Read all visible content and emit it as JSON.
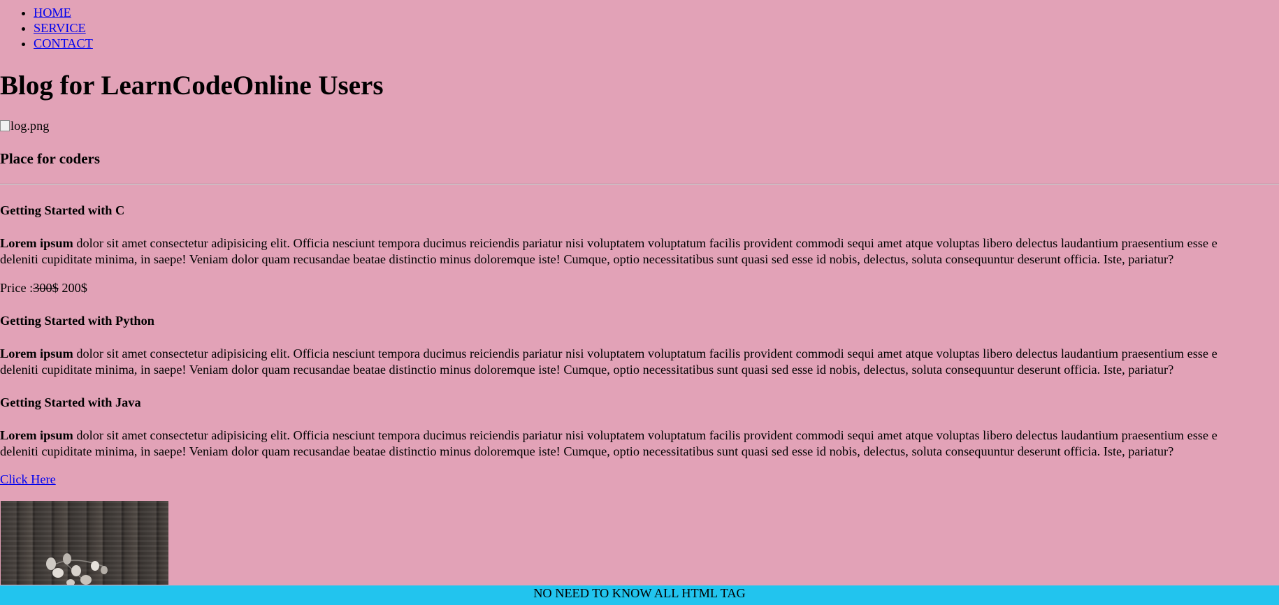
{
  "nav": {
    "items": [
      {
        "label": "HOME"
      },
      {
        "label": "SERVICE"
      },
      {
        "label": "CONTACT"
      }
    ]
  },
  "header": {
    "title": "Blog for LearnCodeOnline Users",
    "logo_alt": "log.png",
    "tagline": "Place for coders"
  },
  "posts": [
    {
      "title": "Getting Started with C",
      "lead": "Lorem ipsum",
      "text": " dolor sit amet consectetur adipisicing elit. Officia nesciunt tempora ducimus reiciendis pariatur nisi voluptatem voluptatum facilis provident commodi sequi amet atque voluptas libero delectus laudantium praesentium esse e",
      "text_line2": "deleniti cupiditate minima, in saepe! Veniam dolor quam recusandae beatae distinctio minus doloremque iste! Cumque, optio necessitatibus sunt quasi sed esse id nobis, delectus, soluta consequuntur deserunt officia. Iste, pariatur?"
    },
    {
      "title": "Getting Started with Python",
      "lead": "Lorem ipsum",
      "text": " dolor sit amet consectetur adipisicing elit. Officia nesciunt tempora ducimus reiciendis pariatur nisi voluptatem voluptatum facilis provident commodi sequi amet atque voluptas libero delectus laudantium praesentium esse e",
      "text_line2": "deleniti cupiditate minima, in saepe! Veniam dolor quam recusandae beatae distinctio minus doloremque iste! Cumque, optio necessitatibus sunt quasi sed esse id nobis, delectus, soluta consequuntur deserunt officia. Iste, pariatur?"
    },
    {
      "title": "Getting Started with Java",
      "lead": "Lorem ipsum",
      "text": " dolor sit amet consectetur adipisicing elit. Officia nesciunt tempora ducimus reiciendis pariatur nisi voluptatem voluptatum facilis provident commodi sequi amet atque voluptas libero delectus laudantium praesentium esse e",
      "text_line2": "deleniti cupiditate minima, in saepe! Veniam dolor quam recusandae beatae distinctio minus doloremque iste! Cumque, optio necessitatibus sunt quasi sed esse id nobis, delectus, soluta consequuntur deserunt officia. Iste, pariatur?"
    }
  ],
  "price": {
    "label": "Price :",
    "old": "300$",
    "new": " 200$"
  },
  "link": {
    "label": "Click Here"
  },
  "footer": {
    "text": "NO NEED TO KNOW ALL HTML TAG"
  },
  "colors": {
    "page_background": "#e2a2b7",
    "footer_background": "#22c4ee",
    "link": "#0000ee"
  }
}
